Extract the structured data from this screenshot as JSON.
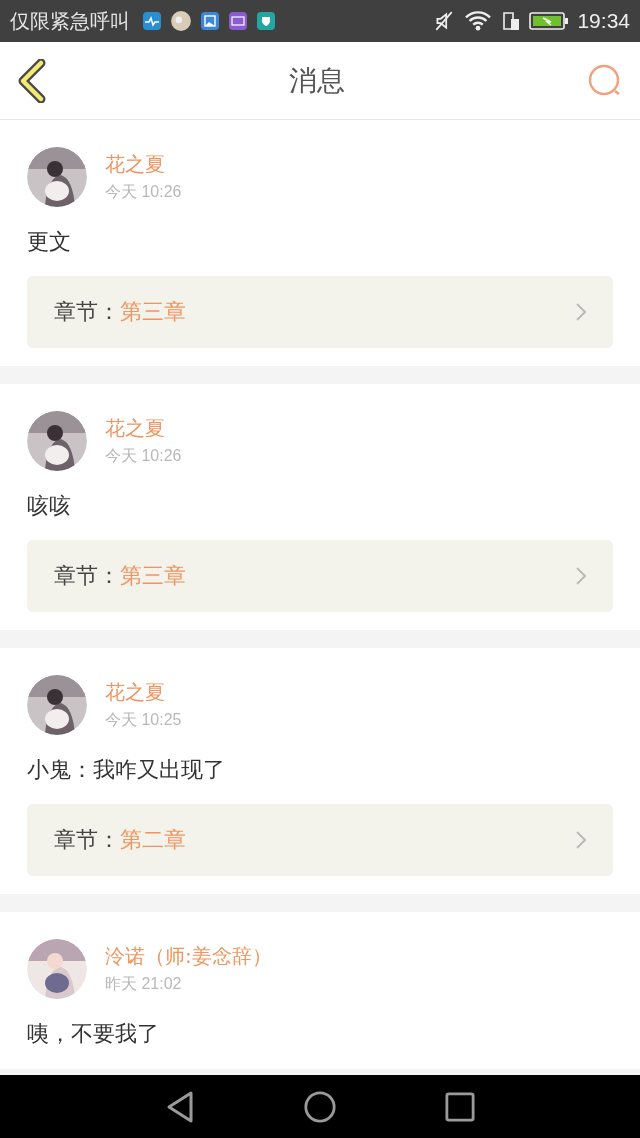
{
  "status_bar": {
    "carrier": "仅限紧急呼叫",
    "time": "19:34"
  },
  "header": {
    "title": "消息"
  },
  "messages": [
    {
      "author": "花之夏",
      "time": "今天 10:26",
      "text": "更文",
      "chapter_label": "章节：",
      "chapter": "第三章"
    },
    {
      "author": "花之夏",
      "time": "今天 10:26",
      "text": "咳咳",
      "chapter_label": "章节：",
      "chapter": "第三章"
    },
    {
      "author": "花之夏",
      "time": "今天 10:25",
      "text": "小鬼：我咋又出现了",
      "chapter_label": "章节：",
      "chapter": "第二章"
    },
    {
      "author": "泠诺（师:姜念辞）",
      "time": "昨天 21:02",
      "text": "咦，不要我了"
    }
  ]
}
